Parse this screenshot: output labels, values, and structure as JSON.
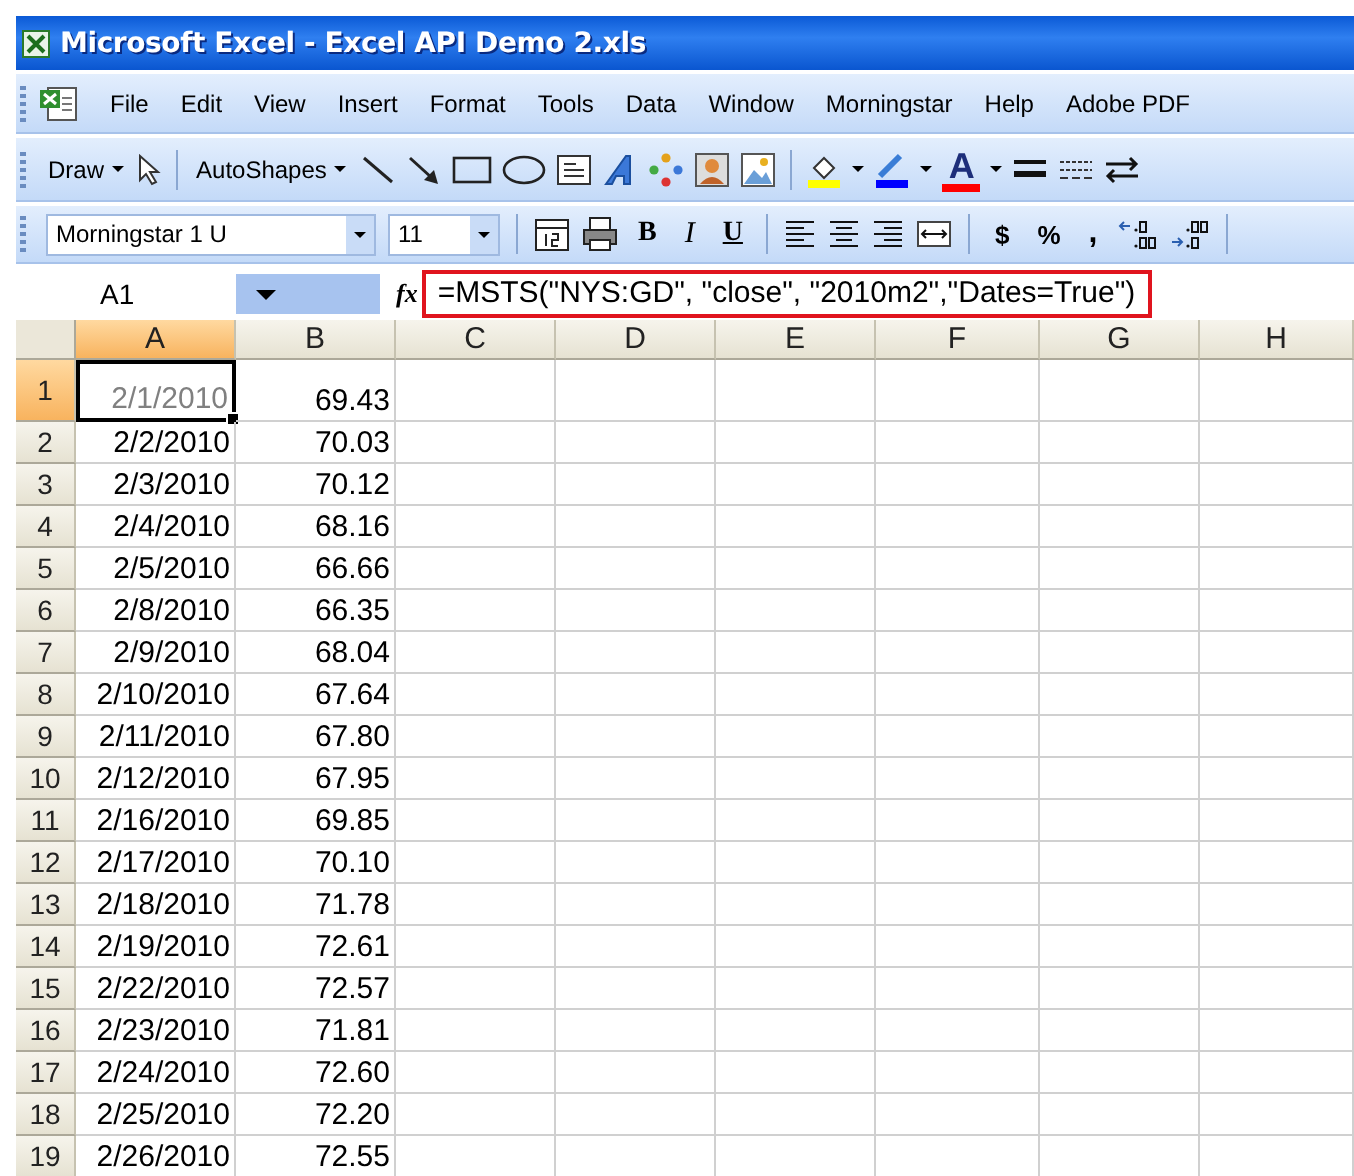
{
  "window": {
    "title": "Microsoft Excel - Excel API Demo 2.xls"
  },
  "menu": [
    "File",
    "Edit",
    "View",
    "Insert",
    "Format",
    "Tools",
    "Data",
    "Window",
    "Morningstar",
    "Help",
    "Adobe PDF"
  ],
  "drawing_toolbar": [
    {
      "kind": "menu",
      "label": "Draw"
    },
    {
      "kind": "menu",
      "label": "AutoShapes"
    },
    {
      "kind": "font-color",
      "label": "A"
    }
  ],
  "formatting_toolbar": [
    {
      "kind": "font",
      "value": "Morningstar 1 U"
    },
    {
      "kind": "size",
      "value": "11"
    },
    {
      "kind": "bold",
      "label": "B"
    },
    {
      "kind": "italic",
      "label": "I"
    },
    {
      "kind": "underline",
      "label": "U"
    },
    {
      "kind": "currency",
      "label": "$"
    },
    {
      "kind": "percent",
      "label": "%"
    },
    {
      "kind": "comma",
      "label": ","
    }
  ],
  "formula_bar": {
    "name_box": "A1",
    "function_label": "fx",
    "formula": "=MSTS(\"NYS:GD\", \"close\", \"2010m2\",\"Dates=True\")",
    "highlighted": true
  },
  "sheet": {
    "columns": [
      {
        "label": "A",
        "selected": true
      },
      {
        "label": "B",
        "selected": false
      },
      {
        "label": "C",
        "selected": false
      },
      {
        "label": "D",
        "selected": false
      },
      {
        "label": "E",
        "selected": false
      },
      {
        "label": "F",
        "selected": false
      },
      {
        "label": "G",
        "selected": false
      },
      {
        "label": "H",
        "selected": false
      }
    ],
    "rows": [
      {
        "number": "1",
        "selected": true,
        "cells": [
          "2/1/2010",
          "69.43"
        ]
      },
      {
        "number": "2",
        "selected": false,
        "cells": [
          "2/2/2010",
          "70.03"
        ]
      },
      {
        "number": "3",
        "selected": false,
        "cells": [
          "2/3/2010",
          "70.12"
        ]
      },
      {
        "number": "4",
        "selected": false,
        "cells": [
          "2/4/2010",
          "68.16"
        ]
      },
      {
        "number": "5",
        "selected": false,
        "cells": [
          "2/5/2010",
          "66.66"
        ]
      },
      {
        "number": "6",
        "selected": false,
        "cells": [
          "2/8/2010",
          "66.35"
        ]
      },
      {
        "number": "7",
        "selected": false,
        "cells": [
          "2/9/2010",
          "68.04"
        ]
      },
      {
        "number": "8",
        "selected": false,
        "cells": [
          "2/10/2010",
          "67.64"
        ]
      },
      {
        "number": "9",
        "selected": false,
        "cells": [
          "2/11/2010",
          "67.80"
        ]
      },
      {
        "number": "10",
        "selected": false,
        "cells": [
          "2/12/2010",
          "67.95"
        ]
      },
      {
        "number": "11",
        "selected": false,
        "cells": [
          "2/16/2010",
          "69.85"
        ]
      },
      {
        "number": "12",
        "selected": false,
        "cells": [
          "2/17/2010",
          "70.10"
        ]
      },
      {
        "number": "13",
        "selected": false,
        "cells": [
          "2/18/2010",
          "71.78"
        ]
      },
      {
        "number": "14",
        "selected": false,
        "cells": [
          "2/19/2010",
          "72.61"
        ]
      },
      {
        "number": "15",
        "selected": false,
        "cells": [
          "2/22/2010",
          "72.57"
        ]
      },
      {
        "number": "16",
        "selected": false,
        "cells": [
          "2/23/2010",
          "71.81"
        ]
      },
      {
        "number": "17",
        "selected": false,
        "cells": [
          "2/24/2010",
          "72.60"
        ]
      },
      {
        "number": "18",
        "selected": false,
        "cells": [
          "2/25/2010",
          "72.20"
        ]
      },
      {
        "number": "19",
        "selected": false,
        "cells": [
          "2/26/2010",
          "72.55"
        ]
      }
    ]
  }
}
